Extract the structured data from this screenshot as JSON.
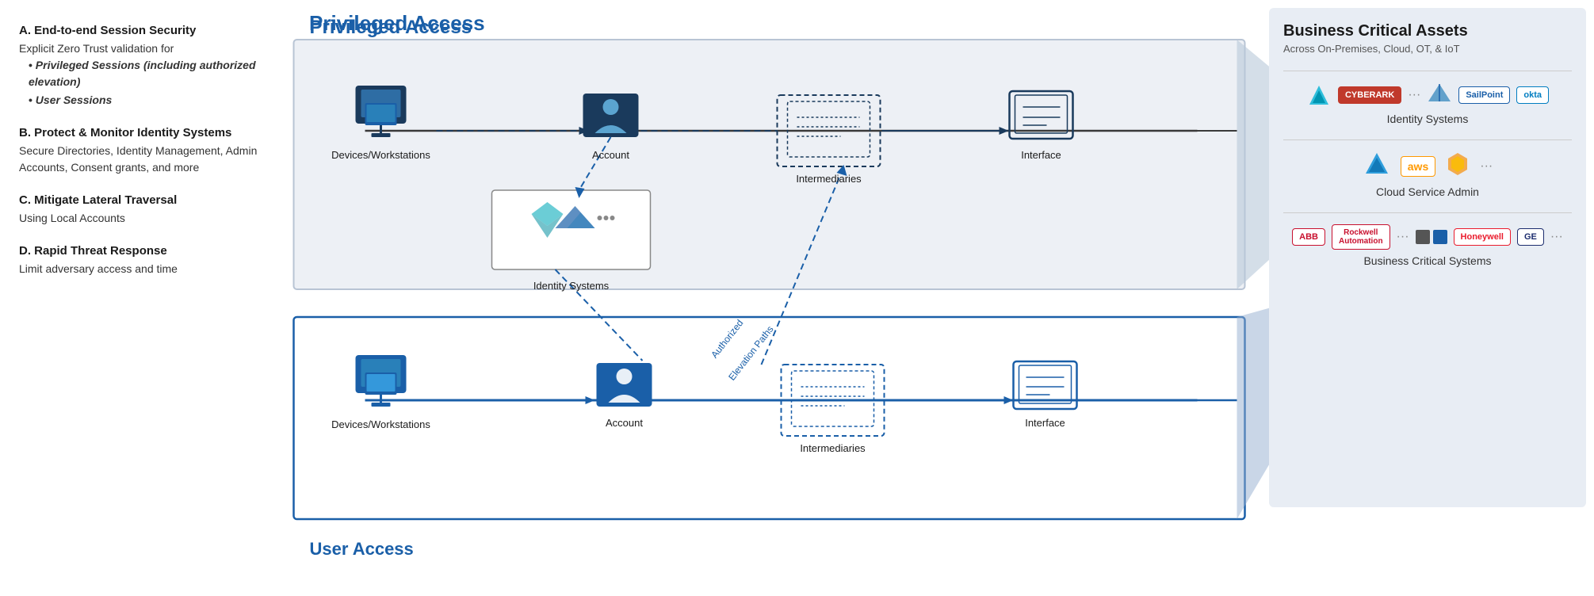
{
  "left_panel": {
    "sections": [
      {
        "id": "A",
        "title": "A. End-to-end Session Security",
        "body": "Explicit Zero Trust validation for",
        "bullets": [
          "Privileged Sessions (including authorized elevation)",
          "User Sessions"
        ]
      },
      {
        "id": "B",
        "title": "B. Protect & Monitor Identity Systems",
        "body": "Secure Directories, Identity Management, Admin Accounts, Consent grants, and more"
      },
      {
        "id": "C",
        "title": "C. Mitigate Lateral Traversal",
        "body": "Using Local Accounts"
      },
      {
        "id": "D",
        "title": "D. Rapid Threat Response",
        "body": "Limit adversary access and time"
      }
    ]
  },
  "diagram": {
    "privileged_access_label": "Privileged Access",
    "user_access_label": "User Access",
    "privileged_row": {
      "nodes": [
        "Devices/Workstations",
        "Account",
        "Intermediaries",
        "Interface"
      ]
    },
    "user_row": {
      "nodes": [
        "Devices/Workstations",
        "Account",
        "Intermediaries",
        "Interface"
      ]
    },
    "identity_systems_label": "Identity Systems",
    "authorized_elevation_label": "Authorized\nElevation Paths"
  },
  "bca_panel": {
    "title": "Business Critical Assets",
    "subtitle": "Across On-Premises, Cloud, OT, & IoT",
    "categories": [
      {
        "label": "Identity Systems",
        "logos": [
          "Ping",
          "CyberArk",
          "SailPoint",
          "okta",
          "..."
        ]
      },
      {
        "label": "Cloud Service Admin",
        "logos": [
          "Azure",
          "aws",
          "GCP",
          "..."
        ]
      },
      {
        "label": "Business Critical Systems",
        "logos": [
          "ABB",
          "Rockwell Automation",
          "Honeywell",
          "GE",
          "..."
        ]
      }
    ]
  }
}
